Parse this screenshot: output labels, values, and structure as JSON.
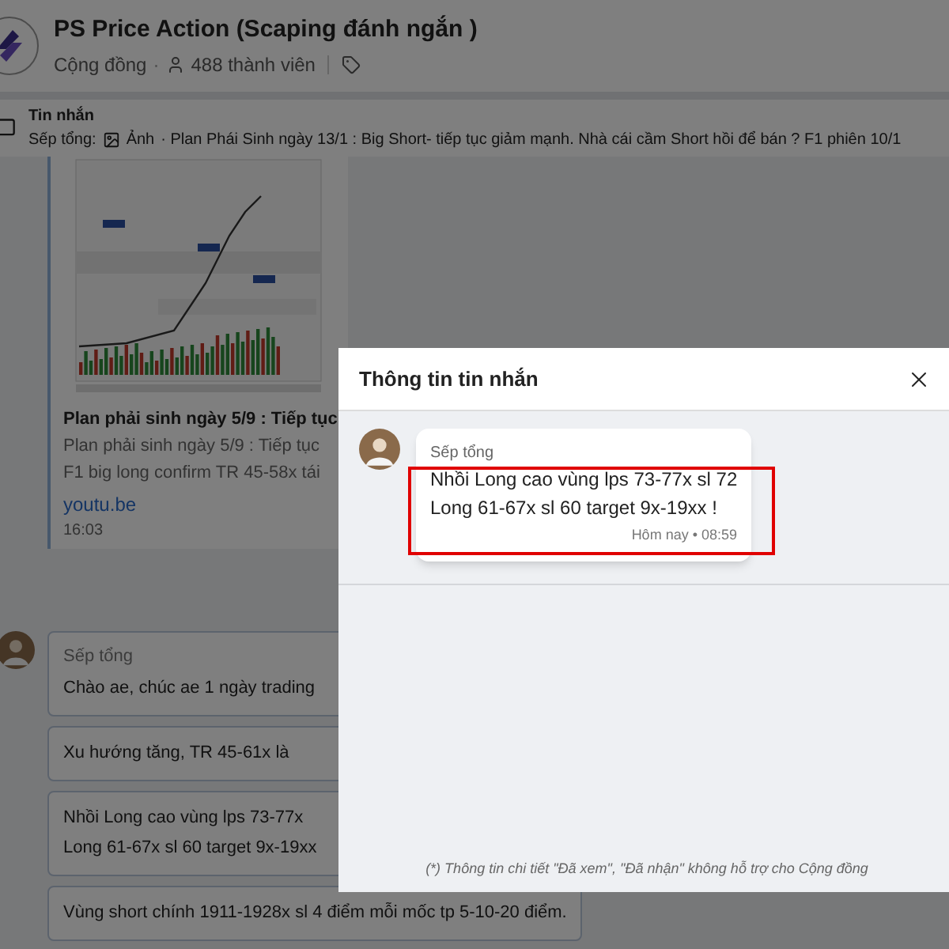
{
  "header": {
    "title": "PS Price Action (Scaping đánh ngắn )",
    "community": "Cộng đồng",
    "separator": "·",
    "members": "488 thành viên"
  },
  "pinned": {
    "label": "Tin nhắn",
    "sender": "Sếp tổng:",
    "attachment": "Ảnh",
    "text": "· Plan Phái Sinh ngày 13/1 : Big Short- tiếp tục giảm mạnh. Nhà cái cầm Short hồi để bán ?  F1 phiên 10/1"
  },
  "link_card": {
    "title": "Plan phải sinh ngày 5/9 : Tiếp tục",
    "description": [
      "Plan phải sinh ngày 5/9 : Tiếp tục",
      "F1 big long confirm TR 45-58x tái"
    ],
    "domain": "youtu.be",
    "time": "16:03"
  },
  "messages": [
    {
      "sender": "Sếp tổng",
      "lines": [
        "Chào ae, chúc ae 1 ngày trading"
      ]
    },
    {
      "lines": [
        "Xu hướng tăng, TR 45-61x là"
      ]
    },
    {
      "lines": [
        "Nhồi Long cao vùng lps 73-77x",
        "Long 61-67x sl 60 target 9x-19xx"
      ]
    },
    {
      "lines": [
        "Vùng short chính 1911-1928x sl 4 điểm mỗi mốc tp 5-10-20 điểm."
      ]
    }
  ],
  "modal": {
    "title": "Thông tin tin nhắn",
    "message": {
      "sender": "Sếp tổng",
      "lines": [
        "Nhồi Long cao vùng lps 73-77x sl 72",
        "Long 61-67x sl 60 target 9x-19xx !"
      ],
      "time": "Hôm nay • 08:59"
    },
    "footnote": "(*) Thông tin chi tiết \"Đã xem\", \"Đã nhận\" không hỗ trợ cho Cộng đồng"
  }
}
